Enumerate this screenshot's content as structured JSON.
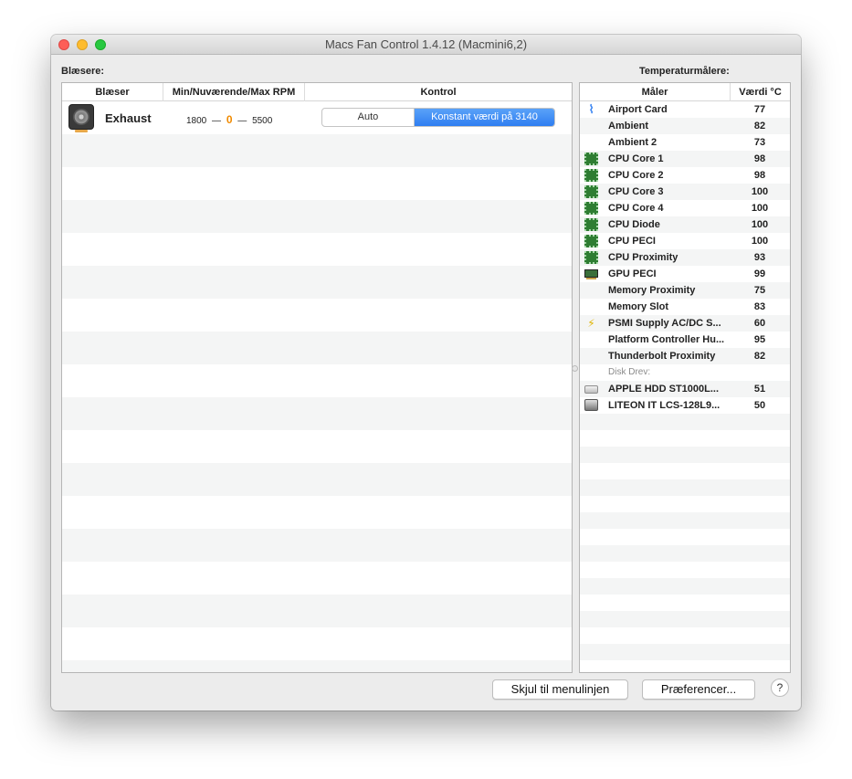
{
  "window": {
    "title": "Macs Fan Control 1.4.12 (Macmini6,2)"
  },
  "fans": {
    "label": "Blæsere:",
    "columns": [
      "Blæser",
      "Min/Nuværende/Max RPM",
      "Kontrol"
    ],
    "rows": [
      {
        "name": "Exhaust",
        "min": "1800",
        "current": "0",
        "max": "5500",
        "dash": "—",
        "control_auto": "Auto",
        "control_constant": "Konstant værdi på 3140"
      }
    ]
  },
  "sensors": {
    "label": "Temperaturmålere:",
    "columns": [
      "Måler",
      "Værdi °C"
    ],
    "rows": [
      {
        "icon": "wifi-icon",
        "name": "Airport Card",
        "value": "77"
      },
      {
        "icon": "",
        "name": "Ambient",
        "value": "82"
      },
      {
        "icon": "",
        "name": "Ambient 2",
        "value": "73"
      },
      {
        "icon": "chip-icon",
        "name": "CPU Core 1",
        "value": "98"
      },
      {
        "icon": "chip-icon",
        "name": "CPU Core 2",
        "value": "98"
      },
      {
        "icon": "chip-icon",
        "name": "CPU Core 3",
        "value": "100"
      },
      {
        "icon": "chip-icon",
        "name": "CPU Core 4",
        "value": "100"
      },
      {
        "icon": "chip-icon",
        "name": "CPU Diode",
        "value": "100"
      },
      {
        "icon": "chip-icon",
        "name": "CPU PECI",
        "value": "100"
      },
      {
        "icon": "chip-icon",
        "name": "CPU Proximity",
        "value": "93"
      },
      {
        "icon": "gpu-icon",
        "name": "GPU PECI",
        "value": "99"
      },
      {
        "icon": "",
        "name": "Memory Proximity",
        "value": "75"
      },
      {
        "icon": "",
        "name": "Memory Slot",
        "value": "83"
      },
      {
        "icon": "bolt-icon",
        "name": "PSMI Supply AC/DC S...",
        "value": "60"
      },
      {
        "icon": "",
        "name": "Platform Controller Hu...",
        "value": "95"
      },
      {
        "icon": "",
        "name": "Thunderbolt Proximity",
        "value": "82"
      }
    ],
    "disk_group_label": "Disk Drev:",
    "disk_rows": [
      {
        "icon": "hdd-icon",
        "name": "APPLE HDD ST1000L...",
        "value": "51"
      },
      {
        "icon": "ssd-icon",
        "name": "LITEON IT LCS-128L9...",
        "value": "50"
      }
    ]
  },
  "footer": {
    "hide_button": "Skjul til menulinjen",
    "prefs_button": "Præferencer...",
    "help_button": "?"
  },
  "colors": {
    "accent": "#2f7ef1",
    "current_rpm": "#f08a00"
  }
}
